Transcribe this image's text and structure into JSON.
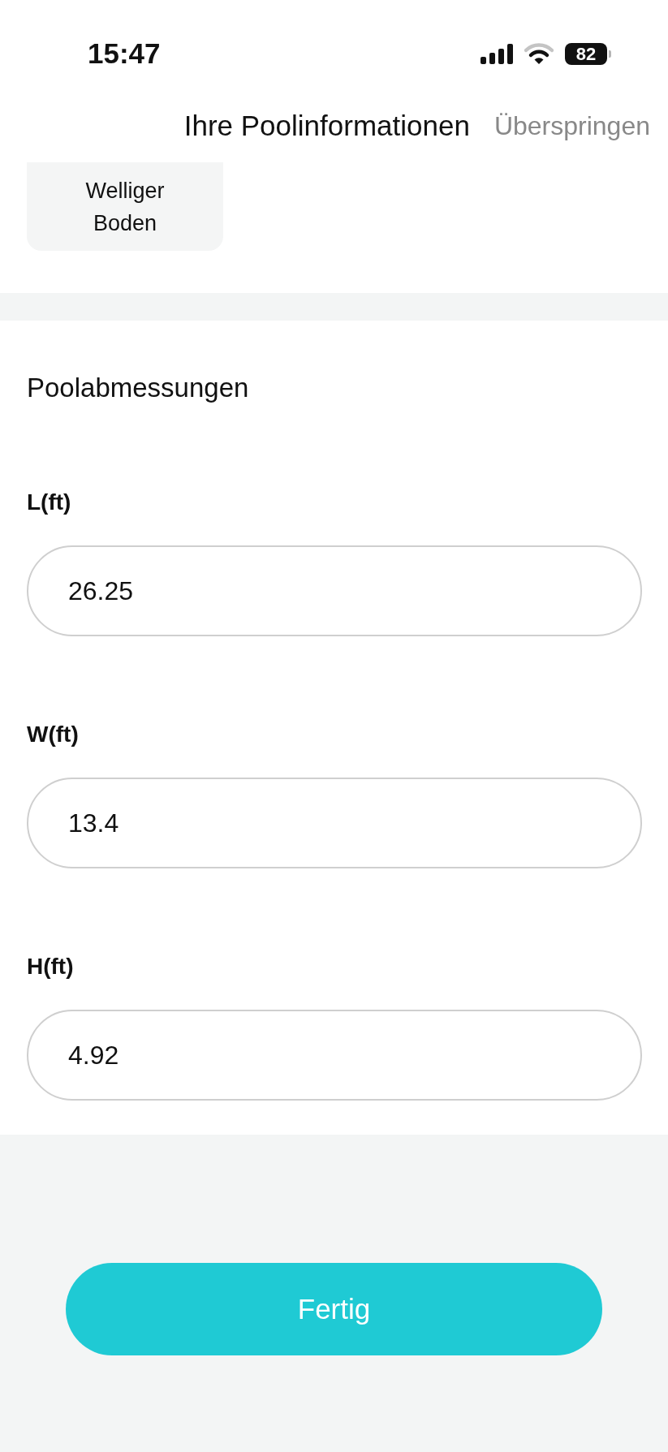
{
  "status_bar": {
    "time": "15:47",
    "battery": "82"
  },
  "header": {
    "title": "Ihre Poolinformationen",
    "skip_button": "Überspringen"
  },
  "floor_options": [
    {
      "label": "Welliger Boden",
      "selected": false
    }
  ],
  "dimensions": {
    "title": "Poolabmessungen",
    "fields": [
      {
        "label": "L(ft)",
        "value": "26.25"
      },
      {
        "label": "W(ft)",
        "value": "13.4"
      },
      {
        "label": "H(ft)",
        "value": "4.92"
      }
    ]
  },
  "done_button": "Fertig"
}
